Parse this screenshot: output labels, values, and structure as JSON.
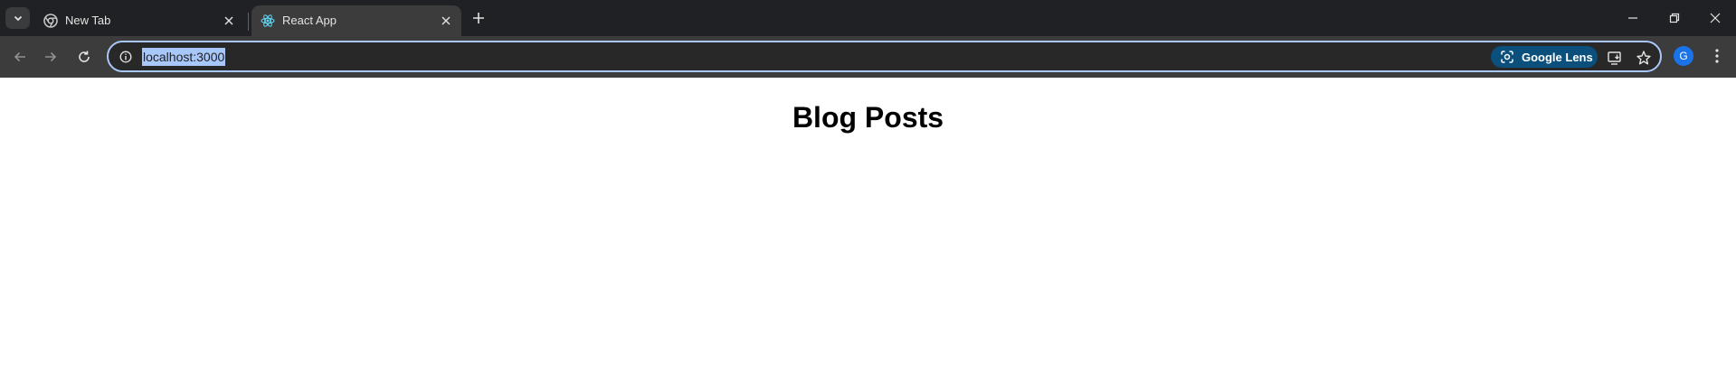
{
  "browser": {
    "tabs": [
      {
        "title": "New Tab",
        "icon": "chrome-icon",
        "active": false
      },
      {
        "title": "React App",
        "icon": "react-icon",
        "active": true
      }
    ],
    "address": "localhost:3000",
    "lens_label": "Google Lens",
    "profile_initial": "G"
  },
  "page": {
    "heading": "Blog Posts"
  },
  "colors": {
    "tabstrip": "#202124",
    "toolbar": "#3c3c3c",
    "omnibox_border": "#a8c7fa",
    "url_selection": "#a8c7fa",
    "lens_chip": "#0b4f7c",
    "avatar": "#1a73e8"
  }
}
